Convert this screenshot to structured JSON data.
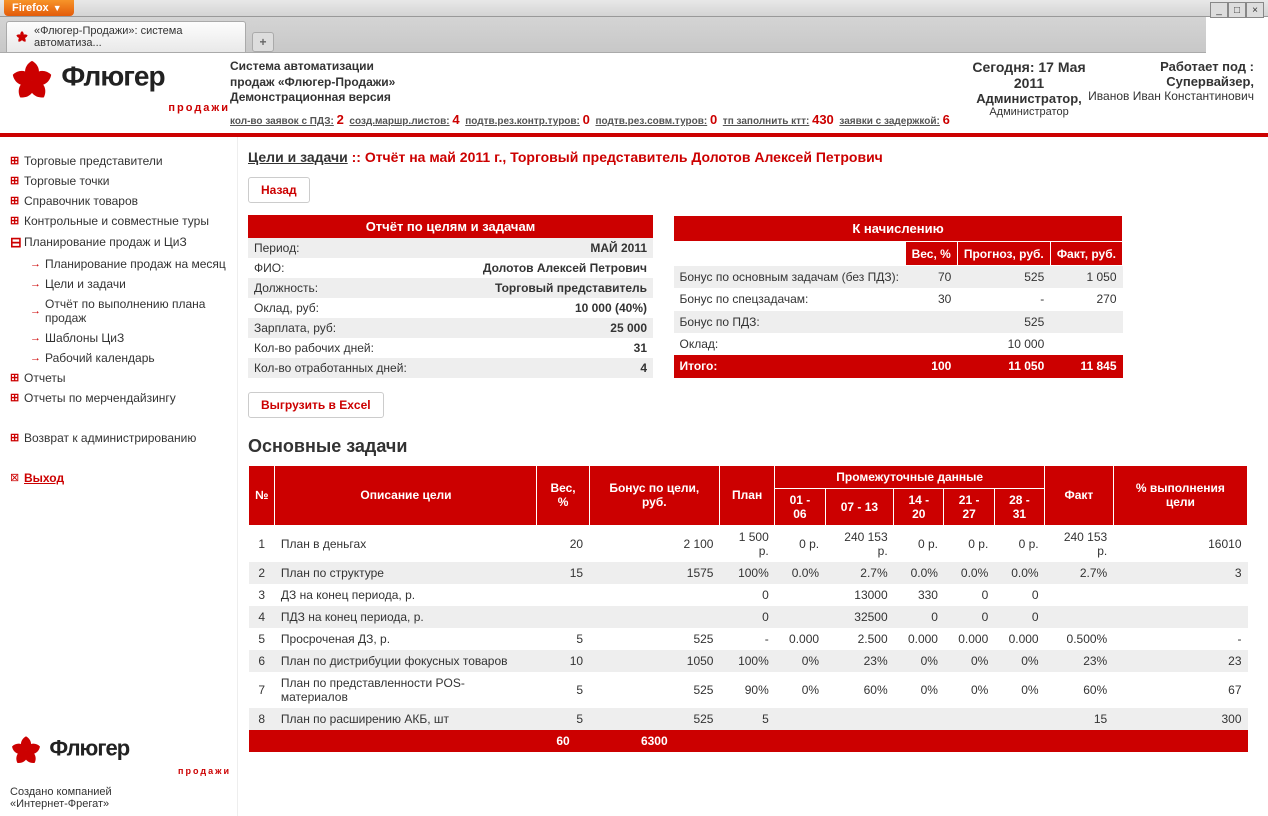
{
  "browser": {
    "firefox_label": "Firefox",
    "tab_title": "«Флюгер-Продажи»: система автоматиза...",
    "new_tab": "+"
  },
  "header": {
    "logo_main": "Флюгер",
    "logo_sub": "продажи",
    "sys1": "Система автоматизации",
    "sys2": "продаж «Флюгер-Продажи»",
    "sys3": "Демонстрационная версия",
    "today_label": "Сегодня: 17 Мая 2011",
    "admin1": "Администратор,",
    "admin2": "Администратор",
    "works_label": "Работает под :",
    "works_role": "Супервайзер,",
    "works_name": "Иванов Иван Константинович",
    "stats": {
      "s1_label": "кол-во заявок с ПДЗ:",
      "s1_val": "2",
      "s2_label": "созд.маршр.листов:",
      "s2_val": "4",
      "s3_label": "подтв.рез.контр.туров:",
      "s3_val": "0",
      "s4_label": "подтв.рез.совм.туров:",
      "s4_val": "0",
      "s5_label": "тп заполнить ктт:",
      "s5_val": "430",
      "s6_label": "заявки с задержкой:",
      "s6_val": "6"
    }
  },
  "sidebar": {
    "i1": "Торговые представители",
    "i2": "Торговые точки",
    "i3": "Справочник товаров",
    "i4": "Контрольные и совместные туры",
    "i5": "Планирование продаж и ЦиЗ",
    "s1": "Планирование продаж на месяц",
    "s2": "Цели и задачи",
    "s3": "Отчёт по выполнению плана продаж",
    "s4": "Шаблоны ЦиЗ",
    "s5": "Рабочий календарь",
    "i6": "Отчеты",
    "i7": "Отчеты по мерчендайзингу",
    "i8": "Возврат к администрированию",
    "exit": "Выход",
    "created": "Создано компанией",
    "company": "«Интернет-Фрегат»"
  },
  "content": {
    "bc_root": "Цели и задачи",
    "bc_sep": " :: ",
    "bc_current": "Отчёт на май 2011 г., Торговый представитель Долотов Алексей Петрович",
    "btn_back": "Назад",
    "btn_excel": "Выгрузить в Excel",
    "report_header": "Отчёт по целям и задачам",
    "period_l": "Период:",
    "period_v": "МАЙ 2011",
    "fio_l": "ФИО:",
    "fio_v": "Долотов Алексей Петрович",
    "pos_l": "Должность:",
    "pos_v": "Торговый представитель",
    "oklad_l": "Оклад, руб:",
    "oklad_v": "10 000 (40%)",
    "sal_l": "Зарплата, руб:",
    "sal_v": "25 000",
    "wd_l": "Кол-во рабочих дней:",
    "wd_v": "31",
    "wkd_l": "Кол-во отработанных дней:",
    "wkd_v": "4",
    "calc_header": "К начислению",
    "calc_h1": "Вес, %",
    "calc_h2": "Прогноз, руб.",
    "calc_h3": "Факт, руб.",
    "calc_r1_l": "Бонус по основным задачам (без ПДЗ):",
    "calc_r1_w": "70",
    "calc_r1_p": "525",
    "calc_r1_f": "1 050",
    "calc_r2_l": "Бонус по спецзадачам:",
    "calc_r2_w": "30",
    "calc_r2_p": "-",
    "calc_r2_f": "270",
    "calc_r3_l": "Бонус по ПДЗ:",
    "calc_r3_p": "525",
    "calc_r4_l": "Оклад:",
    "calc_r4_p": "10 000",
    "calc_total_l": "Итого:",
    "calc_total_w": "100",
    "calc_total_p": "11 050",
    "calc_total_f": "11 845",
    "section_tasks": "Основные задачи",
    "th_n": "№",
    "th_desc": "Описание цели",
    "th_w": "Вес, %",
    "th_bonus": "Бонус по цели, руб.",
    "th_plan": "План",
    "th_inter": "Промежуточные данные",
    "th_d1": "01 - 06",
    "th_d2": "07 - 13",
    "th_d3": "14 - 20",
    "th_d4": "21 - 27",
    "th_d5": "28 - 31",
    "th_fact": "Факт",
    "th_pct": "% выполнения цели",
    "rows": [
      {
        "n": "1",
        "d": "План в деньгах",
        "w": "20",
        "b": "2 100",
        "p": "1 500 р.",
        "d1": "0 р.",
        "d2": "240 153 р.",
        "d3": "0 р.",
        "d4": "0 р.",
        "d5": "0 р.",
        "f": "240 153 р.",
        "pct": "16010"
      },
      {
        "n": "2",
        "d": "План по структуре",
        "w": "15",
        "b": "1575",
        "p": "100%",
        "d1": "0.0%",
        "d2": "2.7%",
        "d3": "0.0%",
        "d4": "0.0%",
        "d5": "0.0%",
        "f": "2.7%",
        "pct": "3"
      },
      {
        "n": "3",
        "d": "ДЗ на конец периода, р.",
        "w": "",
        "b": "",
        "p": "0",
        "d1": "",
        "d2": "13000",
        "d3": "330",
        "d4": "0",
        "d5": "0",
        "f": "",
        "pct": ""
      },
      {
        "n": "4",
        "d": "ПДЗ на конец периода, р.",
        "w": "",
        "b": "",
        "p": "0",
        "d1": "",
        "d2": "32500",
        "d3": "0",
        "d4": "0",
        "d5": "0",
        "f": "",
        "pct": ""
      },
      {
        "n": "5",
        "d": "Просроченая ДЗ, р.",
        "w": "5",
        "b": "525",
        "p": "-",
        "d1": "0.000",
        "d2": "2.500",
        "d3": "0.000",
        "d4": "0.000",
        "d5": "0.000",
        "f": "0.500%",
        "pct": "-"
      },
      {
        "n": "6",
        "d": "План по дистрибуции фокусных товаров",
        "w": "10",
        "b": "1050",
        "p": "100%",
        "d1": "0%",
        "d2": "23%",
        "d3": "0%",
        "d4": "0%",
        "d5": "0%",
        "f": "23%",
        "pct": "23"
      },
      {
        "n": "7",
        "d": "План по представленности POS-материалов",
        "w": "5",
        "b": "525",
        "p": "90%",
        "d1": "0%",
        "d2": "60%",
        "d3": "0%",
        "d4": "0%",
        "d5": "0%",
        "f": "60%",
        "pct": "67"
      },
      {
        "n": "8",
        "d": "План по расширению АКБ, шт",
        "w": "5",
        "b": "525",
        "p": "5",
        "d1": "",
        "d2": "",
        "d3": "",
        "d4": "",
        "d5": "",
        "f": "15",
        "pct": "300"
      }
    ],
    "total_w": "60",
    "total_b": "6300"
  }
}
